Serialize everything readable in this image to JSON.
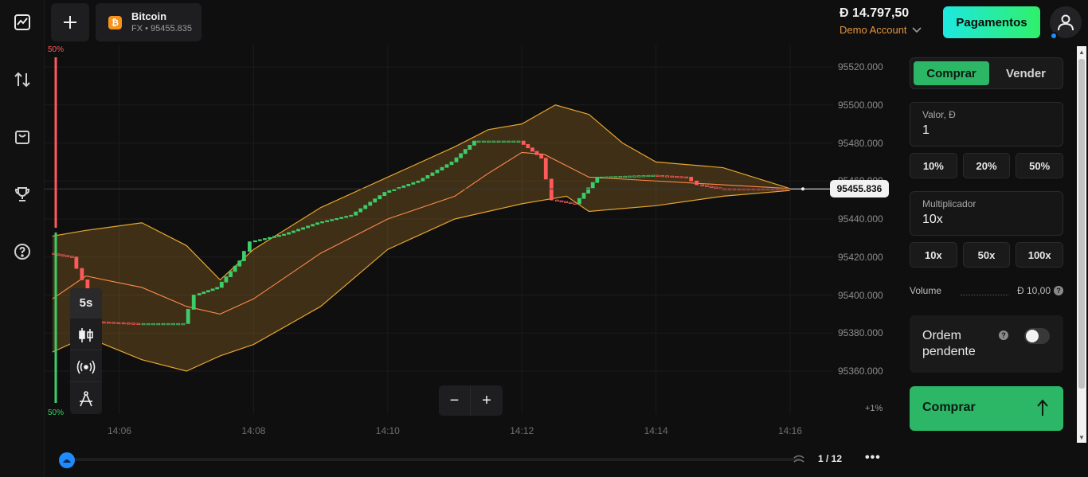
{
  "asset": {
    "name": "Bitcoin",
    "subtitle": "FX • 95455.835",
    "icon_char": "₿"
  },
  "account": {
    "balance": "Đ 14.797,50",
    "type": "Demo Account",
    "deposit_button": "Pagamentos"
  },
  "trade_panel": {
    "tab_buy": "Comprar",
    "tab_sell": "Vender",
    "amount_label": "Valor, Đ",
    "amount_value": "1",
    "amount_presets": [
      "10%",
      "20%",
      "50%"
    ],
    "multiplier_label": "Multiplicador",
    "multiplier_value": "10x",
    "multiplier_presets": [
      "10x",
      "50x",
      "100x"
    ],
    "volume_label": "Volume",
    "volume_value": "Đ 10,00",
    "pending_order_label": "Ordem pendente",
    "pending_order_enabled": false,
    "buy_button": "Comprar"
  },
  "chart": {
    "current_price": "95455.836",
    "timeframe": "5s",
    "sentiment_top": "50%",
    "sentiment_bottom": "50%",
    "axis_percent": "+1%",
    "page": "1 / 12",
    "colors": {
      "up": "#3dcc6a",
      "down": "#ff5a5a",
      "band": "#e6a52e",
      "middle": "#ff8a4a"
    }
  },
  "chart_data": {
    "type": "candlestick",
    "y_ticks": [
      "95520.000",
      "95500.000",
      "95480.000",
      "95460.000",
      "95440.000",
      "95420.000",
      "95400.000",
      "95380.000",
      "95360.000"
    ],
    "x_ticks": [
      "14:06",
      "14:08",
      "14:10",
      "14:12",
      "14:14",
      "14:16"
    ],
    "ylim": [
      95340,
      95528
    ],
    "indicator": "bollinger-bands",
    "price_path": [
      {
        "t": "14:05:00",
        "p": 95422
      },
      {
        "t": "14:05:20",
        "p": 95420
      },
      {
        "t": "14:05:30",
        "p": 95408
      },
      {
        "t": "14:05:40",
        "p": 95386
      },
      {
        "t": "14:06:20",
        "p": 95385
      },
      {
        "t": "14:07:00",
        "p": 95385
      },
      {
        "t": "14:07:10",
        "p": 95400
      },
      {
        "t": "14:07:30",
        "p": 95404
      },
      {
        "t": "14:07:50",
        "p": 95418
      },
      {
        "t": "14:08:00",
        "p": 95428
      },
      {
        "t": "14:08:30",
        "p": 95432
      },
      {
        "t": "14:09:00",
        "p": 95438
      },
      {
        "t": "14:09:30",
        "p": 95442
      },
      {
        "t": "14:10:00",
        "p": 95454
      },
      {
        "t": "14:10:30",
        "p": 95460
      },
      {
        "t": "14:11:00",
        "p": 95470
      },
      {
        "t": "14:11:20",
        "p": 95481
      },
      {
        "t": "14:12:00",
        "p": 95481
      },
      {
        "t": "14:12:20",
        "p": 95472
      },
      {
        "t": "14:12:30",
        "p": 95450
      },
      {
        "t": "14:12:50",
        "p": 95448
      },
      {
        "t": "14:13:10",
        "p": 95462
      },
      {
        "t": "14:14:00",
        "p": 95463
      },
      {
        "t": "14:14:30",
        "p": 95462
      },
      {
        "t": "14:14:40",
        "p": 95458
      },
      {
        "t": "14:15:00",
        "p": 95456
      },
      {
        "t": "14:16:00",
        "p": 95455.836
      }
    ],
    "band_upper": [
      {
        "t": "14:05:00",
        "p": 95431
      },
      {
        "t": "14:05:30",
        "p": 95434
      },
      {
        "t": "14:06:20",
        "p": 95438
      },
      {
        "t": "14:07:00",
        "p": 95426
      },
      {
        "t": "14:07:30",
        "p": 95408
      },
      {
        "t": "14:08:00",
        "p": 95424
      },
      {
        "t": "14:09:00",
        "p": 95446
      },
      {
        "t": "14:10:00",
        "p": 95462
      },
      {
        "t": "14:11:00",
        "p": 95478
      },
      {
        "t": "14:11:30",
        "p": 95487
      },
      {
        "t": "14:12:00",
        "p": 95490
      },
      {
        "t": "14:12:30",
        "p": 95500
      },
      {
        "t": "14:13:00",
        "p": 95495
      },
      {
        "t": "14:13:30",
        "p": 95480
      },
      {
        "t": "14:14:00",
        "p": 95470
      },
      {
        "t": "14:15:00",
        "p": 95467
      },
      {
        "t": "14:16:00",
        "p": 95456
      }
    ],
    "band_middle": [
      {
        "t": "14:05:00",
        "p": 95398
      },
      {
        "t": "14:05:30",
        "p": 95410
      },
      {
        "t": "14:06:20",
        "p": 95404
      },
      {
        "t": "14:07:00",
        "p": 95394
      },
      {
        "t": "14:07:30",
        "p": 95390
      },
      {
        "t": "14:08:00",
        "p": 95398
      },
      {
        "t": "14:09:00",
        "p": 95422
      },
      {
        "t": "14:10:00",
        "p": 95440
      },
      {
        "t": "14:11:00",
        "p": 95452
      },
      {
        "t": "14:11:30",
        "p": 95464
      },
      {
        "t": "14:12:00",
        "p": 95475
      },
      {
        "t": "14:12:20",
        "p": 95474
      },
      {
        "t": "14:13:00",
        "p": 95462
      },
      {
        "t": "14:14:00",
        "p": 95460
      },
      {
        "t": "14:15:00",
        "p": 95458
      },
      {
        "t": "14:16:00",
        "p": 95456
      }
    ],
    "band_lower": [
      {
        "t": "14:05:00",
        "p": 95370
      },
      {
        "t": "14:05:30",
        "p": 95378
      },
      {
        "t": "14:06:20",
        "p": 95366
      },
      {
        "t": "14:07:00",
        "p": 95360
      },
      {
        "t": "14:07:30",
        "p": 95368
      },
      {
        "t": "14:08:00",
        "p": 95374
      },
      {
        "t": "14:09:00",
        "p": 95394
      },
      {
        "t": "14:10:00",
        "p": 95424
      },
      {
        "t": "14:11:00",
        "p": 95440
      },
      {
        "t": "14:12:00",
        "p": 95448
      },
      {
        "t": "14:12:40",
        "p": 95452
      },
      {
        "t": "14:13:00",
        "p": 95444
      },
      {
        "t": "14:14:00",
        "p": 95447
      },
      {
        "t": "14:15:00",
        "p": 95452
      },
      {
        "t": "14:16:00",
        "p": 95455
      }
    ]
  }
}
